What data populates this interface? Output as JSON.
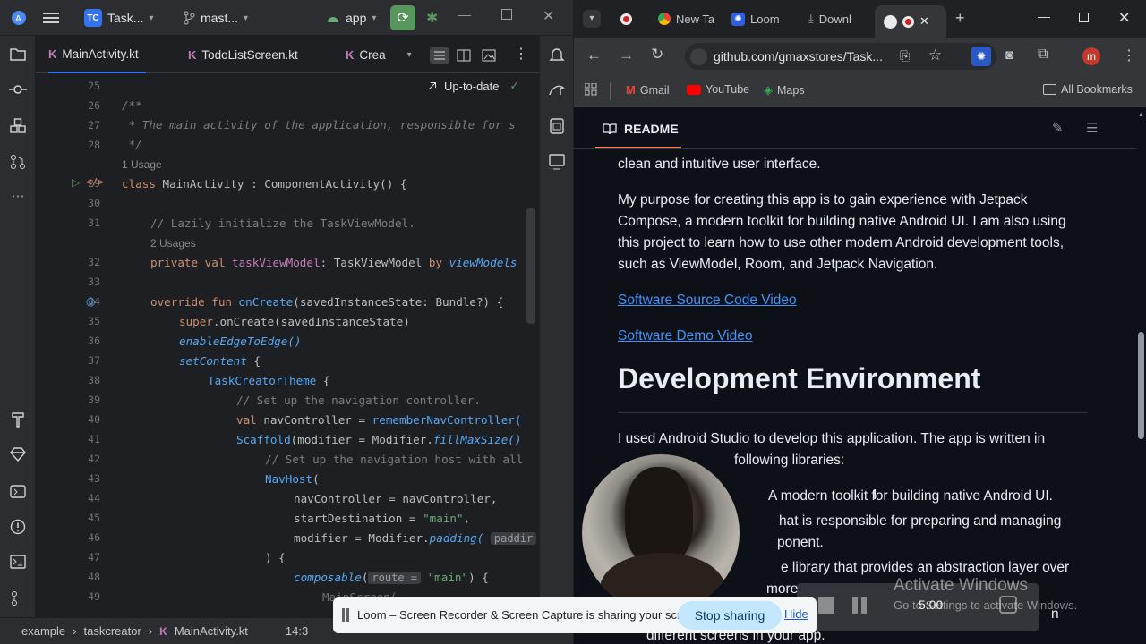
{
  "ide": {
    "project_badge": "TC",
    "project_name": "Task...",
    "branch": "mast...",
    "run_config": "app",
    "tabs": [
      {
        "label": "MainActivity.kt"
      },
      {
        "label": "TodoListScreen.kt"
      },
      {
        "label": "Crea"
      }
    ],
    "status": "Up-to-date",
    "line_numbers": [
      "25",
      "26",
      "27",
      "28",
      "29",
      "30",
      "31",
      "32",
      "33",
      "34",
      "35",
      "36",
      "37",
      "38",
      "39",
      "40",
      "41",
      "42",
      "43",
      "44",
      "45",
      "46",
      "47",
      "48",
      "49"
    ],
    "code": {
      "l26": "/**",
      "l27": " * The main activity of the application, responsible for s",
      "l28": " */",
      "usage1": "1 Usage",
      "l29_kw": "class",
      "l29_rest": " MainActivity : ComponentActivity() {",
      "l31": "// Lazily initialize the TaskViewModel.",
      "usage2": "2 Usages",
      "l32_kw": "private val",
      "l32_prop": " taskViewModel",
      "l32_rest": ": TaskViewModel ",
      "l32_by": "by",
      "l32_fn": " viewModels",
      "l34_kw": "override fun",
      "l34_fn": " onCreate",
      "l34_rest": "(savedInstanceState: Bundle?) {",
      "l35_kw": "super",
      "l35_rest": ".onCreate(savedInstanceState)",
      "l36": "enableEdgeToEdge()",
      "l37_fn": "setContent",
      "l37_rest": " {",
      "l38_fn": "TaskCreatorTheme",
      "l38_rest": " {",
      "l39": "// Set up the navigation controller.",
      "l40_kw": "val",
      "l40_rest": " navController = ",
      "l40_fn": "rememberNavController(",
      "l41_fn": "Scaffold",
      "l41_rest": "(modifier = Modifier.",
      "l41_it": "fillMaxSize()",
      "l42": "// Set up the navigation host with all",
      "l43_fn": "NavHost",
      "l43_rest": "(",
      "l44": "navController = navController,",
      "l45_a": "startDestination = ",
      "l45_str": "\"main\"",
      "l45_b": ",",
      "l46_a": "modifier = Modifier.",
      "l46_it": "padding(",
      "l46_hint": "paddir",
      "l47": ") {",
      "l48_fn": "composable",
      "l48_a": "(",
      "l48_hint": "route =",
      "l48_str": " \"main\"",
      "l48_b": ") {",
      "l49": "MainScreen(..."
    },
    "breadcrumb": [
      "example",
      "taskcreator",
      "MainActivity.kt"
    ],
    "position": "14:3"
  },
  "browser": {
    "tabs": [
      {
        "label": ""
      },
      {
        "label": "New Ta"
      },
      {
        "label": "Loom"
      },
      {
        "label": "Downl"
      }
    ],
    "url": "github.com/gmaxstores/Task...",
    "bookmarks": [
      {
        "label": "Gmail"
      },
      {
        "label": "YouTube"
      },
      {
        "label": "Maps"
      }
    ],
    "all_bookmarks": "All Bookmarks",
    "profile_initial": "m",
    "readme_label": "README",
    "readme": {
      "p0": "clean and intuitive user interface.",
      "p1": "My purpose for creating this app is to gain experience with Jetpack Compose, a modern toolkit for building native Android UI. I am also using this project to learn how to use other modern Android development tools, such as ViewModel, Room, and Jetpack Navigation.",
      "link1": "Software Source Code Video",
      "link2": "Software Demo Video",
      "heading": "Development Environment",
      "p2a": "I used Android Studio to develop this application. The app is written in",
      "p2b": "following libraries:",
      "li1": "A modern toolkit for building native Android UI.",
      "li2a": "hat is responsible for preparing and managing",
      "li2b": "ponent.",
      "li3a": "e library that provides an abstraction layer over",
      "li3b": "more",
      "li4a": "n",
      "li4b": "different screens in your app."
    }
  },
  "loom": {
    "message": "Loom – Screen Recorder & Screen Capture is sharing your screen.",
    "stop": "Stop sharing",
    "hide": "Hide"
  },
  "overlay": {
    "activate_title": "Activate Windows",
    "activate_sub": "Go to Settings to activate Windows.",
    "time": "5:00"
  }
}
